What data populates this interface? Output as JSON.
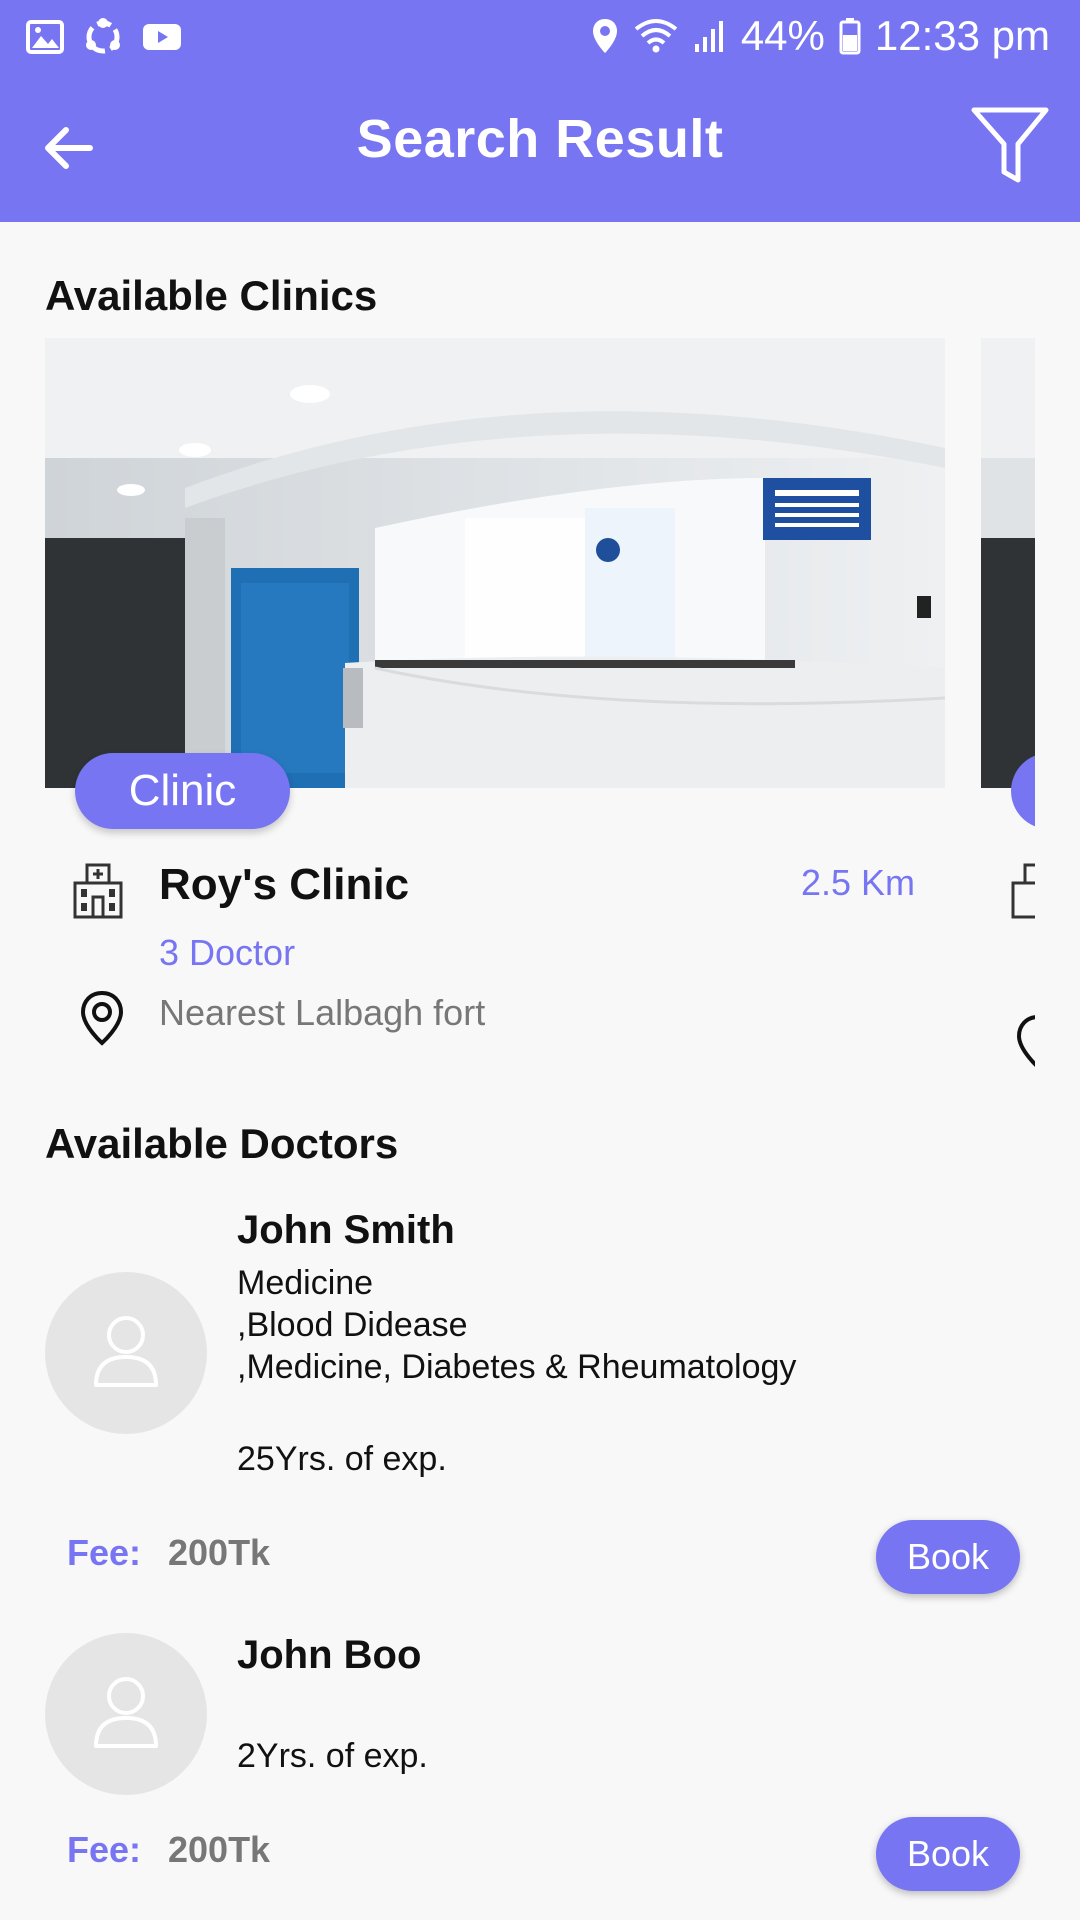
{
  "status_bar": {
    "battery_percent": "44%",
    "time": "12:33 pm",
    "icons": [
      "image-icon",
      "sync-icon",
      "youtube-icon",
      "location-icon",
      "wifi-icon",
      "signal-icon",
      "battery-icon"
    ]
  },
  "app_bar": {
    "title": "Search Result",
    "icons": [
      "back-arrow-icon",
      "filter-icon"
    ],
    "color": "#7775f2"
  },
  "clinics_section": {
    "title": "Available Clinics",
    "clinics": [
      {
        "chip": "Clinic",
        "name": "Roy's Clinic",
        "distance": "2.5 Km",
        "doctors": "3 Doctor",
        "address": "Nearest Lalbagh fort"
      }
    ]
  },
  "doctors_section": {
    "title": "Available Doctors",
    "doctors": [
      {
        "name": "John Smith",
        "specialties": "Medicine\n,Blood Didease\n,Medicine, Diabetes & Rheumatology",
        "experience": "25Yrs. of exp.",
        "fee_label": "Fee:",
        "fee": "200Tk",
        "book_label": "Book"
      },
      {
        "name": "John Boo",
        "specialties": "",
        "experience": "2Yrs. of exp.",
        "fee_label": "Fee:",
        "fee": "200Tk",
        "book_label": "Book"
      }
    ]
  }
}
